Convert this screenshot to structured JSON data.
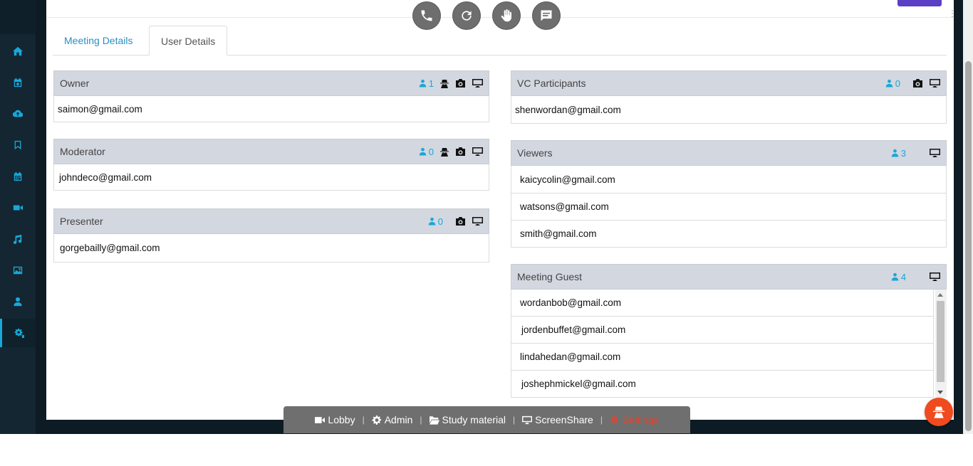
{
  "tabs": {
    "meeting_details": "Meeting Details",
    "user_details": "User Details"
  },
  "left_column": [
    {
      "title": "Owner",
      "count": "1",
      "emails": [
        "saimon@gmail.com"
      ],
      "icons": [
        "user-icon",
        "spy-icon",
        "camera-icon",
        "monitor-icon"
      ]
    },
    {
      "title": "Moderator",
      "count": "0",
      "emails": [
        "johndeco@gmail.com"
      ],
      "icons": [
        "user-icon",
        "spy-icon",
        "camera-icon",
        "monitor-icon"
      ]
    },
    {
      "title": "Presenter",
      "count": "0",
      "emails": [
        "gorgebailly@gmail.com"
      ],
      "icons": [
        "user-icon",
        "camera-icon",
        "monitor-icon"
      ]
    }
  ],
  "right_column": [
    {
      "title": "VC Participants",
      "count": "0",
      "emails": [
        "shenwordan@gmail.com"
      ],
      "icons": [
        "user-icon",
        "camera-icon",
        "monitor-icon"
      ]
    },
    {
      "title": "Viewers",
      "count": "3",
      "emails": [
        "kaicycolin@gmail.com",
        "watsons@gmail.com",
        "smith@gmail.com"
      ],
      "icons": [
        "user-icon",
        "monitor-icon"
      ]
    },
    {
      "title": "Meeting Guest",
      "count": "4",
      "emails": [
        "wordanbob@gmail.com",
        "jordenbuffet@gmail.com",
        "lindahedan@gmail.com",
        "joshephmickel@gmail.com"
      ],
      "icons": [
        "user-icon",
        "monitor-icon"
      ]
    }
  ],
  "call_controls": [
    "phone-icon",
    "refresh-icon",
    "hand-icon",
    "chat-icon"
  ],
  "sidebar": {
    "items": [
      "home-icon",
      "calendar-plus-icon",
      "cloud-upload-icon",
      "bookmark-icon",
      "calendar-icon",
      "video-icon",
      "music-icon",
      "image-icon",
      "user-icon",
      "settings-icon"
    ],
    "active_index": 9
  },
  "bottom_bar": {
    "lobby": "Lobby",
    "admin": "Admin",
    "study_material": "Study material",
    "screenshare": "ScreenShare",
    "settings": "Settings"
  },
  "colors": {
    "accent": "#19a7d9",
    "header_bg": "#d3d7df",
    "settings_red": "#e8422c",
    "fab": "#f04a1f",
    "sidebar_bg": "#132631"
  }
}
